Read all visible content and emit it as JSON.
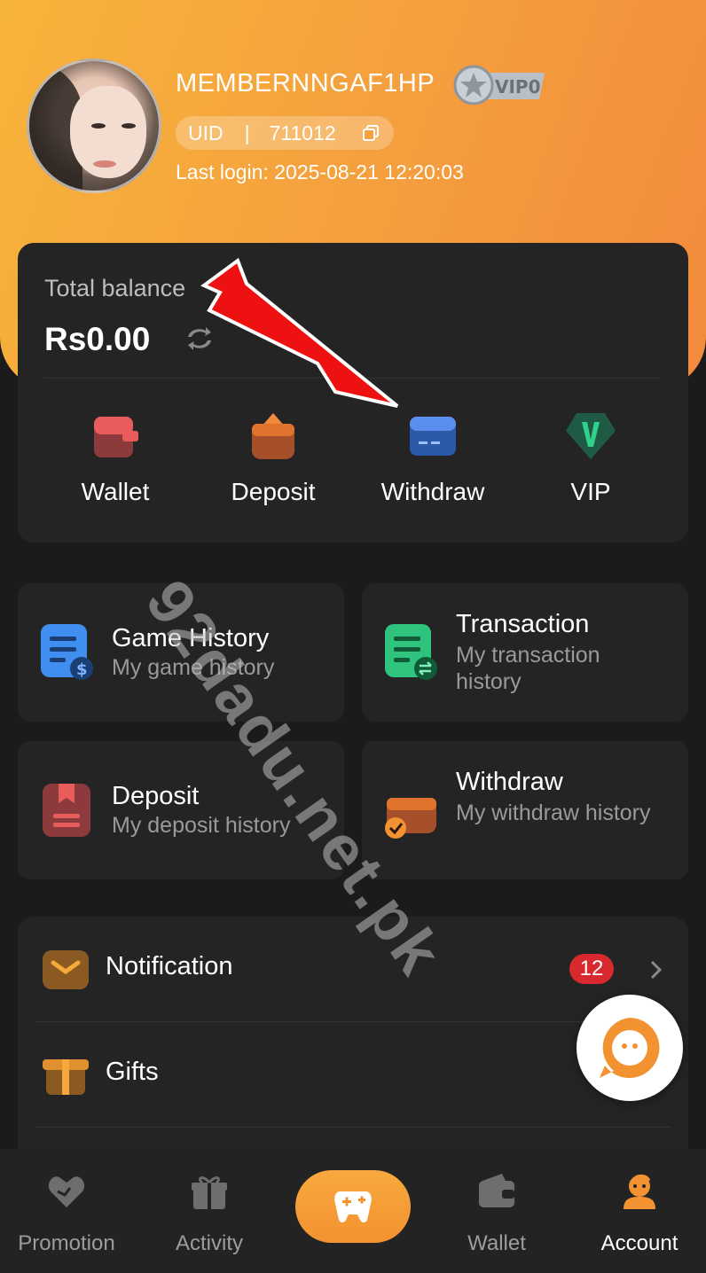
{
  "profile": {
    "username": "MEMBERNNGAF1HP",
    "vip_level": "VIP0",
    "uid_label": "UID",
    "uid_separator": "|",
    "uid_value": "711012",
    "last_login": "Last login: 2025-08-21 12:20:03"
  },
  "balance": {
    "label": "Total balance",
    "value": "Rs0.00"
  },
  "quick_actions": [
    {
      "label": "Wallet",
      "icon": "wallet-icon"
    },
    {
      "label": "Deposit",
      "icon": "deposit-icon"
    },
    {
      "label": "Withdraw",
      "icon": "withdraw-card-icon"
    },
    {
      "label": "VIP",
      "icon": "vip-shield-icon"
    }
  ],
  "history_tiles": [
    {
      "title": "Game History",
      "subtitle": "My game history",
      "icon": "game-history-icon"
    },
    {
      "title": "Transaction",
      "subtitle": "My transaction history",
      "icon": "transaction-icon"
    },
    {
      "title": "Deposit",
      "subtitle": "My deposit history",
      "icon": "deposit-history-icon"
    },
    {
      "title": "Withdraw",
      "subtitle": "My withdraw history",
      "icon": "withdraw-history-icon"
    }
  ],
  "menu": [
    {
      "label": "Notification",
      "badge": "12",
      "icon": "mail-icon"
    },
    {
      "label": "Gifts",
      "icon": "gift-icon"
    }
  ],
  "watermark": "92dadu.net.pk",
  "bottom_nav": [
    {
      "label": "Promotion",
      "icon": "promotion-icon"
    },
    {
      "label": "Activity",
      "icon": "activity-icon"
    },
    {
      "label": "",
      "icon": "game-controller-icon"
    },
    {
      "label": "Wallet",
      "icon": "wallet-nav-icon"
    },
    {
      "label": "Account",
      "icon": "account-icon",
      "active": true
    }
  ],
  "colors": {
    "header_gradient_start": "#f7b43a",
    "header_gradient_end": "#f28a3c",
    "background": "#1b1b1b",
    "card": "#242424",
    "badge_red": "#d8292f",
    "accent_orange": "#f39231"
  }
}
